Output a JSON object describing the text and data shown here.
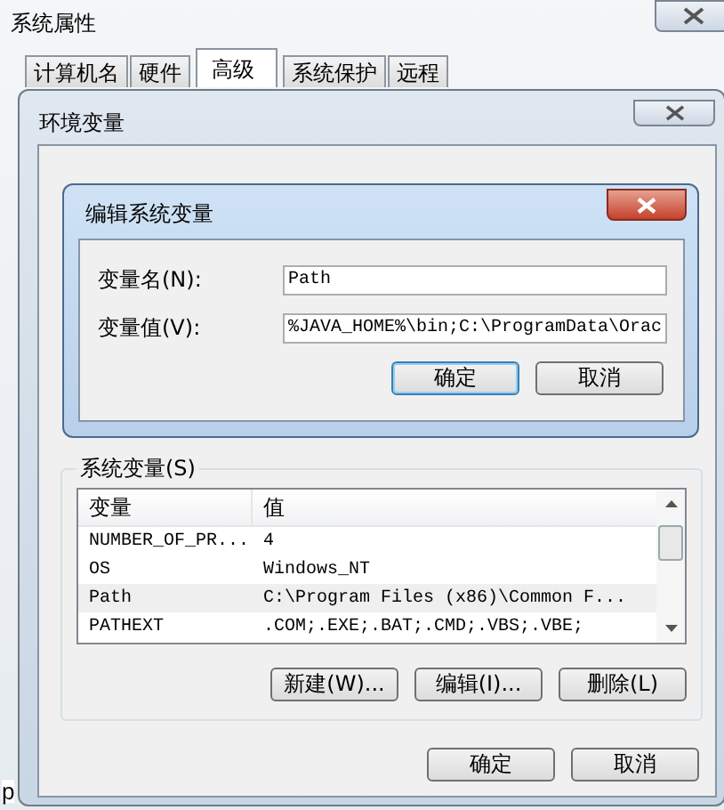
{
  "outer_window": {
    "title": "系统属性",
    "tabs": [
      {
        "label": "计算机名",
        "selected": false
      },
      {
        "label": "硬件",
        "selected": false
      },
      {
        "label": "高级",
        "selected": true
      },
      {
        "label": "系统保护",
        "selected": false
      },
      {
        "label": "远程",
        "selected": false
      }
    ],
    "fragment": "p"
  },
  "env_window": {
    "title": "环境变量",
    "system_group": {
      "label": "系统变量(S)",
      "columns": [
        "变量",
        "值"
      ],
      "rows": [
        {
          "name": "NUMBER_OF_PR...",
          "value": "4",
          "selected": false
        },
        {
          "name": "OS",
          "value": "Windows_NT",
          "selected": false
        },
        {
          "name": "Path",
          "value": "C:\\Program Files (x86)\\Common F...",
          "selected": true
        },
        {
          "name": "PATHEXT",
          "value": ".COM;.EXE;.BAT;.CMD;.VBS;.VBE;",
          "selected": false
        }
      ],
      "buttons": [
        "新建(W)...",
        "编辑(I)...",
        "删除(L)"
      ]
    },
    "buttons": [
      "确定",
      "取消"
    ]
  },
  "edit_dialog": {
    "title": "编辑系统变量",
    "fields": [
      {
        "label": "变量名(N):",
        "value": "Path"
      },
      {
        "label": "变量值(V):",
        "value": "%JAVA_HOME%\\bin;C:\\ProgramData\\Orac"
      }
    ],
    "buttons": [
      {
        "label": "确定",
        "default": true
      },
      {
        "label": "取消",
        "default": false
      }
    ]
  }
}
